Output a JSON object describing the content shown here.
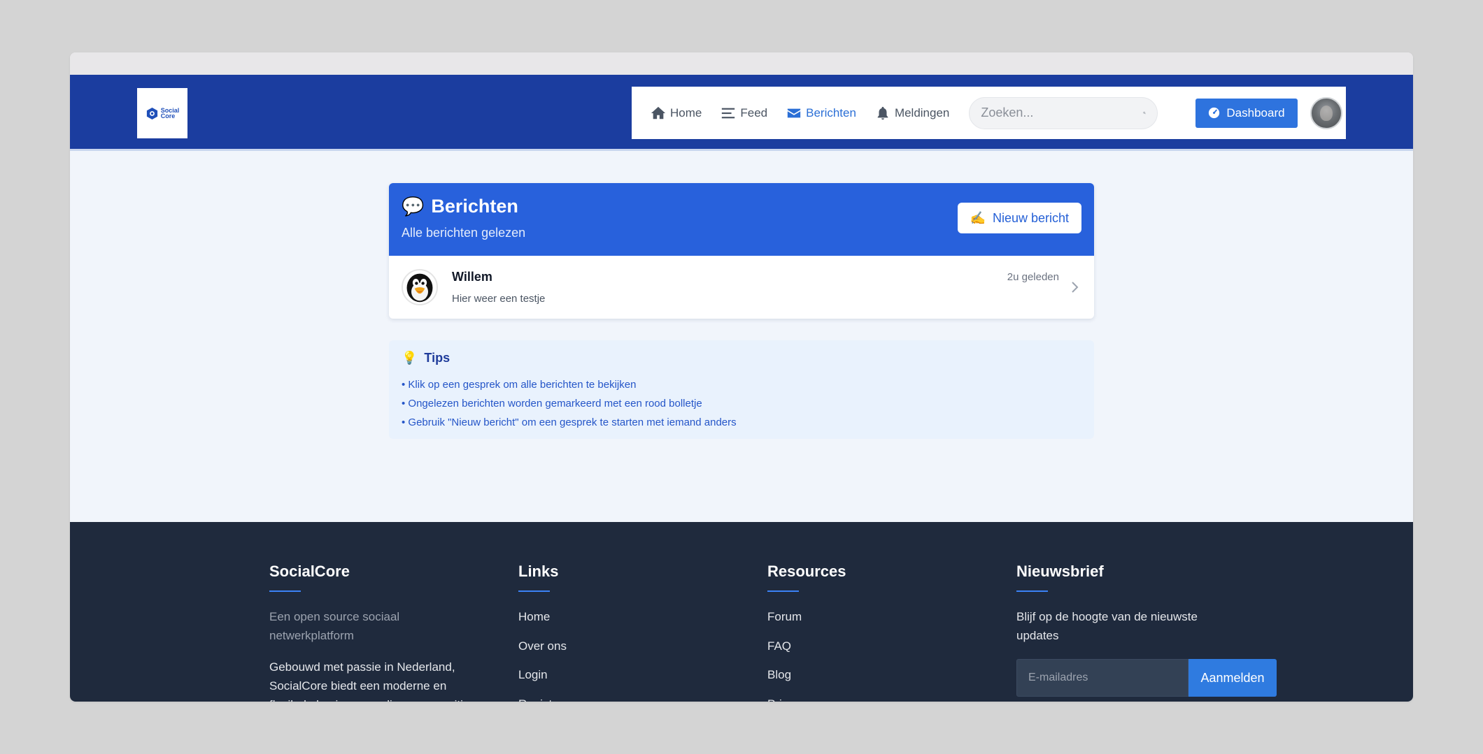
{
  "brand": {
    "logo_line1": "Social",
    "logo_line2": "Core"
  },
  "nav": {
    "items": [
      {
        "label": "Home",
        "icon": "home-icon"
      },
      {
        "label": "Feed",
        "icon": "menu-icon"
      },
      {
        "label": "Berichten",
        "icon": "envelope-icon",
        "active": true
      },
      {
        "label": "Meldingen",
        "icon": "bell-icon"
      }
    ],
    "search_placeholder": "Zoeken...",
    "dashboard_label": "Dashboard"
  },
  "messages": {
    "title": "Berichten",
    "subtitle": "Alle berichten gelezen",
    "new_button": "Nieuw bericht",
    "conversations": [
      {
        "name": "Willem",
        "preview": "Hier weer een testje",
        "time": "2u geleden"
      }
    ]
  },
  "tips": {
    "title": "Tips",
    "items": [
      "• Klik op een gesprek om alle berichten te bekijken",
      "• Ongelezen berichten worden gemarkeerd met een rood bolletje",
      "• Gebruik \"Nieuw bericht\" om een gesprek te starten met iemand anders"
    ]
  },
  "footer": {
    "about": {
      "title": "SocialCore",
      "tagline": "Een open source sociaal netwerkplatform",
      "description": "Gebouwd met passie in Nederland, SocialCore biedt een moderne en flexibele basis voor online communities"
    },
    "links": {
      "title": "Links",
      "items": [
        "Home",
        "Over ons",
        "Login",
        "Registreren"
      ]
    },
    "resources": {
      "title": "Resources",
      "items": [
        "Forum",
        "FAQ",
        "Blog",
        "Privacy"
      ]
    },
    "newsletter": {
      "title": "Nieuwsbrief",
      "text": "Blijf op de hoogte van de nieuwste updates",
      "email_placeholder": "E-mailadres",
      "button": "Aanmelden"
    }
  },
  "colors": {
    "header": "#1b3d9f",
    "accent": "#2861dc",
    "footer": "#1f2a3d"
  }
}
